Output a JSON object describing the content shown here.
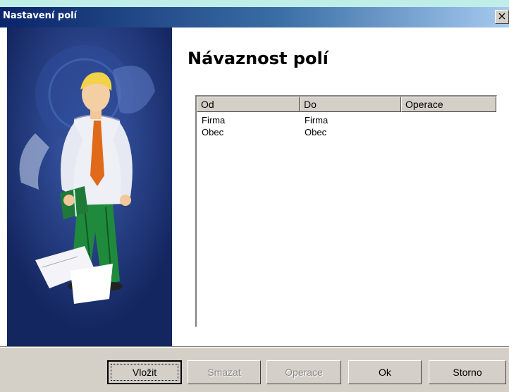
{
  "window": {
    "title": "Nastavení polí",
    "close_glyph": "×"
  },
  "main": {
    "heading": "Návaznost polí"
  },
  "list": {
    "columns": [
      "Od",
      "Do",
      "Operace"
    ],
    "rows": [
      {
        "od": "Firma",
        "do": "Firma",
        "operace": ""
      },
      {
        "od": "Obec",
        "do": "Obec",
        "operace": ""
      }
    ]
  },
  "buttons": {
    "insert": "Vložit",
    "delete": "Smazat",
    "operation": "Operace",
    "ok": "Ok",
    "cancel": "Storno"
  },
  "colors": {
    "titlebar_start": "#0a246a",
    "titlebar_end": "#a6caf0",
    "illustration_bg": "#1b2f6e",
    "dialog_face": "#d4d0c8"
  }
}
